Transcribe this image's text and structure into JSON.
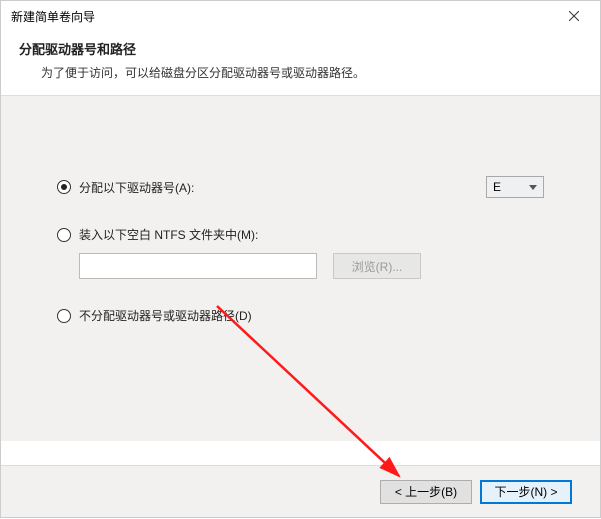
{
  "window": {
    "title": "新建简单卷向导"
  },
  "header": {
    "title": "分配驱动器号和路径",
    "desc": "为了便于访问，可以给磁盘分区分配驱动器号或驱动器路径。"
  },
  "options": {
    "assign_letter": {
      "label": "分配以下驱动器号(A):",
      "selected_value": "E"
    },
    "mount_folder": {
      "label": "装入以下空白 NTFS 文件夹中(M):",
      "path": ""
    },
    "no_assign": {
      "label": "不分配驱动器号或驱动器路径(D)"
    },
    "browse_label": "浏览(R)..."
  },
  "buttons": {
    "back": "< 上一步(B)",
    "next": "下一步(N) >"
  }
}
